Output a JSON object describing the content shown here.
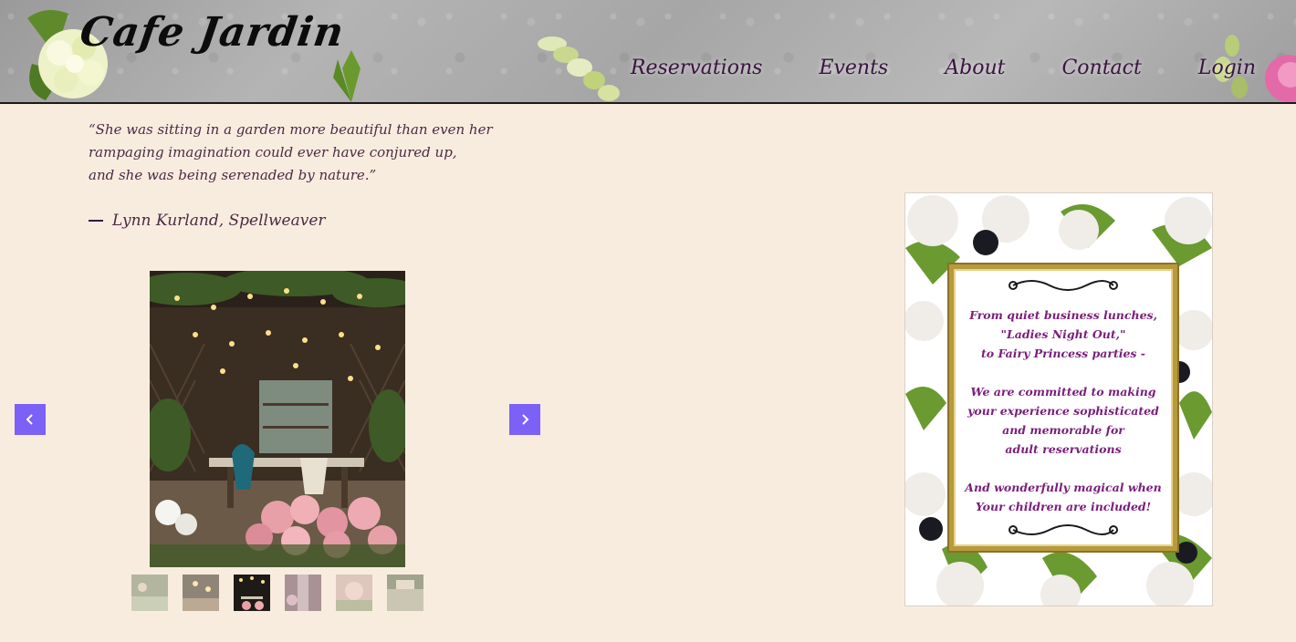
{
  "header": {
    "logo": "Cafe Jardin",
    "nav": [
      {
        "label": "Reservations"
      },
      {
        "label": "Events"
      },
      {
        "label": "About"
      },
      {
        "label": "Contact"
      },
      {
        "label": "Login"
      }
    ]
  },
  "quote": {
    "lines": [
      "“She was sitting in a garden more beautiful than even her",
      "rampaging imagination could ever have conjured up,",
      "and she was being serenaded by nature.”"
    ],
    "attribution": "Lynn Kurland, Spellweaver"
  },
  "carousel": {
    "prev_icon": "chevron-left-icon",
    "next_icon": "chevron-right-icon",
    "accent": "#7b61f5",
    "thumbnail_count": 6,
    "active_thumbnail": 3
  },
  "promo_card": {
    "lines": [
      "From quiet business lunches,",
      "\"Ladies Night Out,\"",
      "to Fairy Princess parties -",
      "",
      "We are committed to making",
      "your experience sophisticated",
      "and memorable for",
      "adult reservations",
      "",
      "And wonderfully magical when",
      "Your children are included!"
    ],
    "text_color": "#7a1e7c"
  }
}
